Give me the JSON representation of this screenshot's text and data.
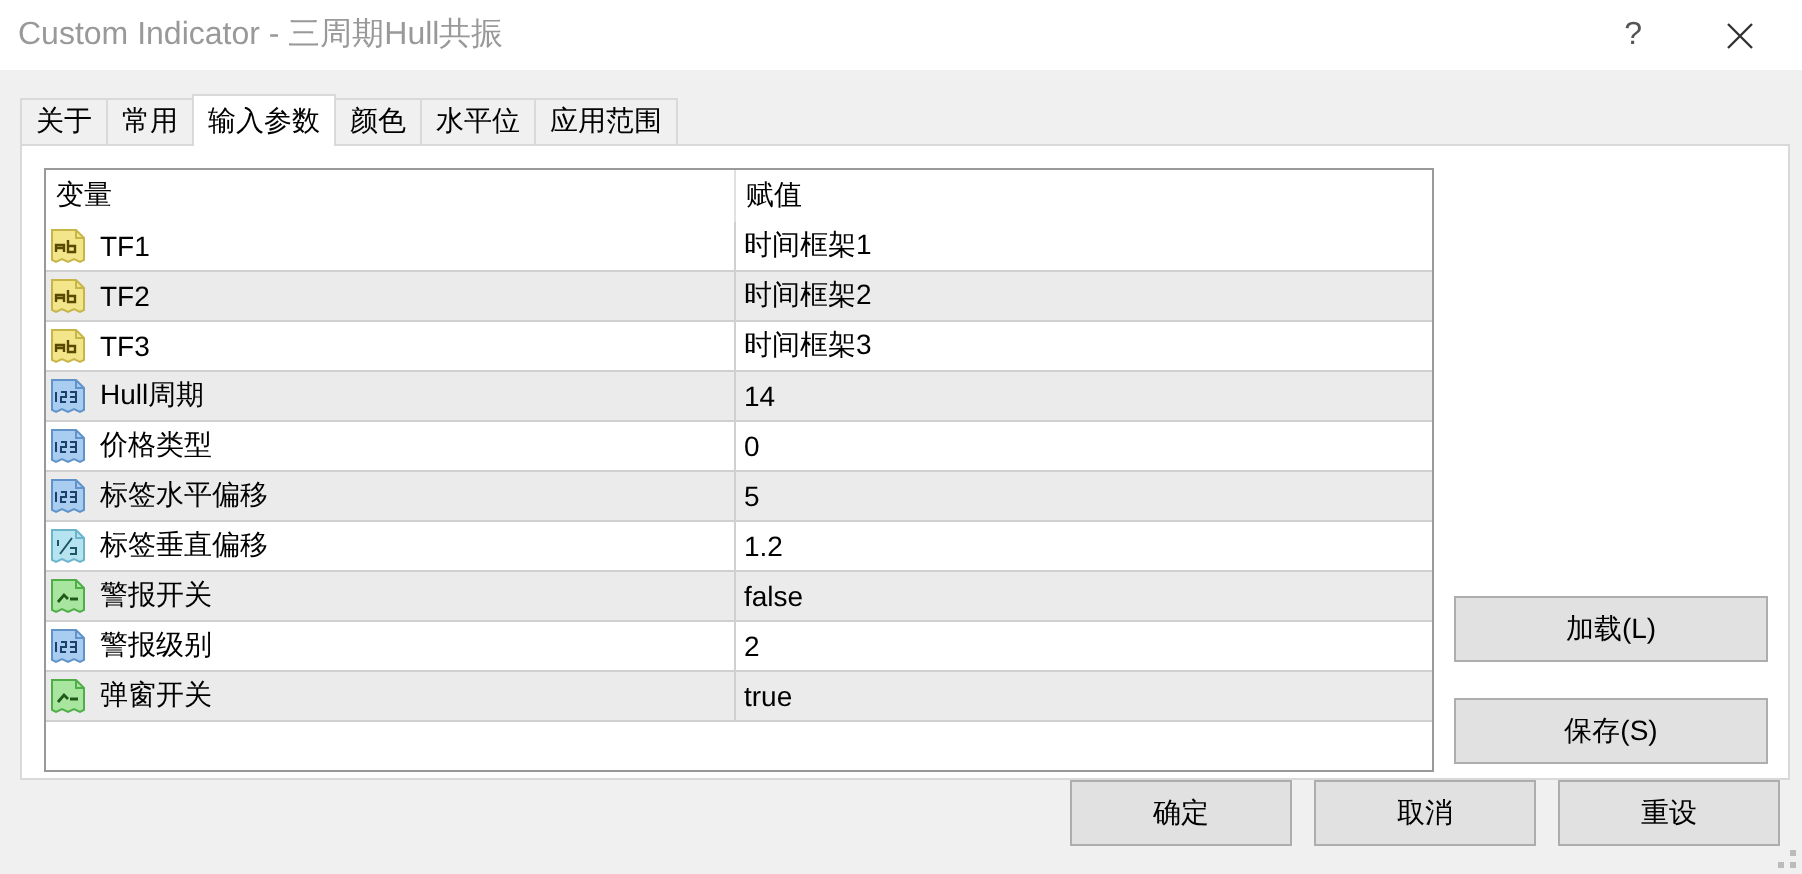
{
  "window": {
    "title": "Custom Indicator - 三周期Hull共振",
    "help": "?"
  },
  "tabs": [
    {
      "label": "关于",
      "selected": false
    },
    {
      "label": "常用",
      "selected": false
    },
    {
      "label": "输入参数",
      "selected": true
    },
    {
      "label": "颜色",
      "selected": false
    },
    {
      "label": "水平位",
      "selected": false
    },
    {
      "label": "应用范围",
      "selected": false
    }
  ],
  "table": {
    "columns": [
      "变量",
      "赋值"
    ],
    "rows": [
      {
        "kind": "string",
        "name": "TF1",
        "value": "时间框架1"
      },
      {
        "kind": "string",
        "name": "TF2",
        "value": "时间框架2"
      },
      {
        "kind": "string",
        "name": "TF3",
        "value": "时间框架3"
      },
      {
        "kind": "integer",
        "name": "Hull周期",
        "value": "14"
      },
      {
        "kind": "integer",
        "name": "价格类型",
        "value": "0"
      },
      {
        "kind": "integer",
        "name": "标签水平偏移",
        "value": "5"
      },
      {
        "kind": "double",
        "name": "标签垂直偏移",
        "value": "1.2"
      },
      {
        "kind": "bool",
        "name": "警报开关",
        "value": "false"
      },
      {
        "kind": "integer",
        "name": "警报级别",
        "value": "2"
      },
      {
        "kind": "bool",
        "name": "弹窗开关",
        "value": "true"
      }
    ]
  },
  "side_buttons": [
    "加载(L)",
    "保存(S)"
  ],
  "buttons": [
    "确定",
    "取消",
    "重设"
  ]
}
